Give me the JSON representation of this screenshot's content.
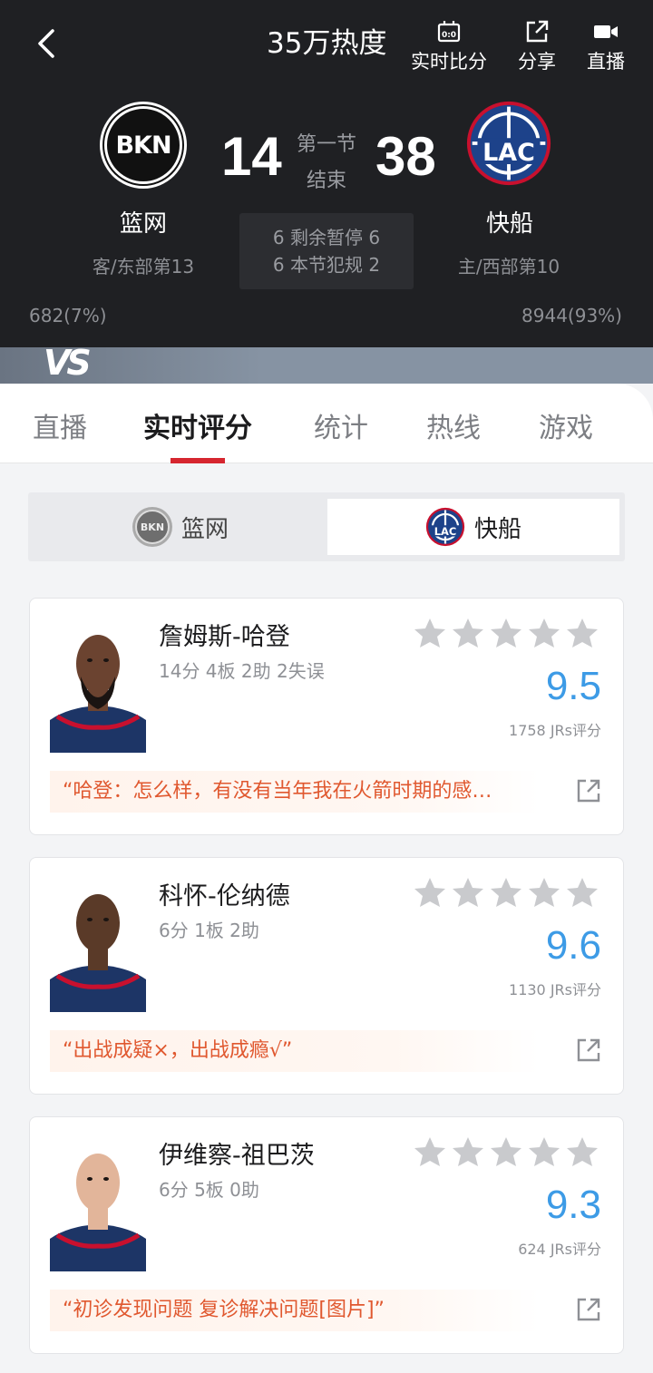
{
  "header": {
    "heat": "35万热度",
    "tools": [
      {
        "label": "实时比分",
        "icon": "scoreboard-icon"
      },
      {
        "label": "分享",
        "icon": "share-icon"
      },
      {
        "label": "直播",
        "icon": "video-camera-icon"
      }
    ]
  },
  "game": {
    "away": {
      "abbr": "BKN",
      "name": "篮网",
      "sub": "客/东部第13",
      "score": "14",
      "votes": "682(7%)"
    },
    "home": {
      "abbr": "LAC",
      "name": "快船",
      "sub": "主/西部第10",
      "score": "38",
      "votes": "8944(93%)"
    },
    "period_line1": "第一节",
    "period_line2": "结束",
    "timeouts": "6 剩余暂停 6",
    "fouls": "6 本节犯规 2",
    "vs": "VS"
  },
  "tabs": [
    "直播",
    "实时评分",
    "统计",
    "热线",
    "游戏"
  ],
  "active_tab": "实时评分",
  "switcher": {
    "away_label": "篮网",
    "home_label": "快船",
    "selected": "快船"
  },
  "players": [
    {
      "name": "詹姆斯-哈登",
      "stats": "14分 4板 2助 2失误",
      "rating": "9.5",
      "rating_count": "1758 JRs评分",
      "quote": "“哈登：怎么样，有没有当年我在火箭时期的感…",
      "skin": "#6b4330",
      "beard": true
    },
    {
      "name": "科怀-伦纳德",
      "stats": "6分 1板 2助",
      "rating": "9.6",
      "rating_count": "1130 JRs评分",
      "quote": "“出战成疑×，出战成瘾√”",
      "skin": "#5a3a28",
      "beard": false
    },
    {
      "name": "伊维察-祖巴茨",
      "stats": "6分 5板 0助",
      "rating": "9.3",
      "rating_count": "624 JRs评分",
      "quote": "“初诊发现问题 复诊解决问题[图片]”",
      "skin": "#e2b59a",
      "beard": false
    }
  ],
  "colors": {
    "accent_red": "#d6262f",
    "rating_blue": "#3d9be6",
    "quote_orange": "#e0582f",
    "header_bg": "#1f2023"
  }
}
